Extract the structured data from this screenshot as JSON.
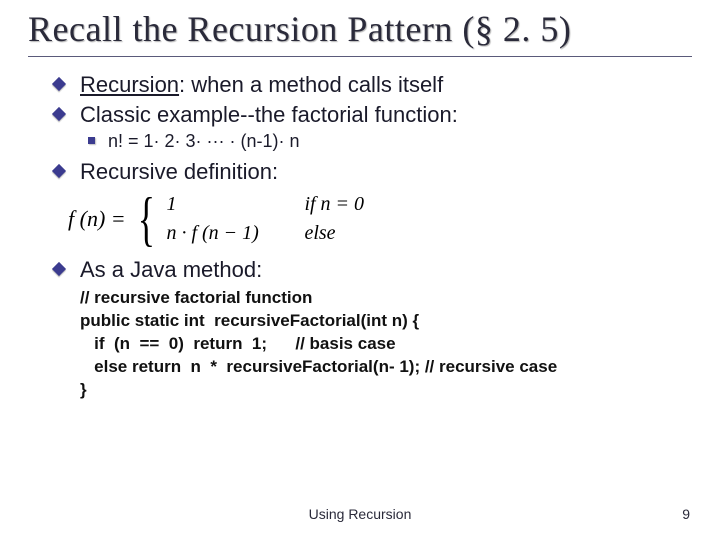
{
  "title": "Recall the Recursion Pattern (§ 2. 5)",
  "bullets": {
    "b1_prefix": "Recursion",
    "b1_rest": ": when a method calls itself",
    "b2": "Classic example--the factorial function:",
    "b2_sub": "n! = 1· 2· 3· ··· · (n-1)· n",
    "b3": "Recursive definition:",
    "b4": "As a Java method:"
  },
  "equation": {
    "lhs": "f (n) =",
    "case1_val": "1",
    "case1_cond": "if n = 0",
    "case2_val": "n · f (n − 1)",
    "case2_cond": "else"
  },
  "code": {
    "l1": "// recursive factorial function",
    "l2": "public static int  recursiveFactorial(int n) {",
    "l3": "   if  (n  ==  0)  return  1;      // basis case",
    "l4": "   else return  n  *  recursiveFactorial(n- 1); // recursive case",
    "l5": "}"
  },
  "footer": {
    "center": "Using Recursion",
    "page": "9"
  }
}
